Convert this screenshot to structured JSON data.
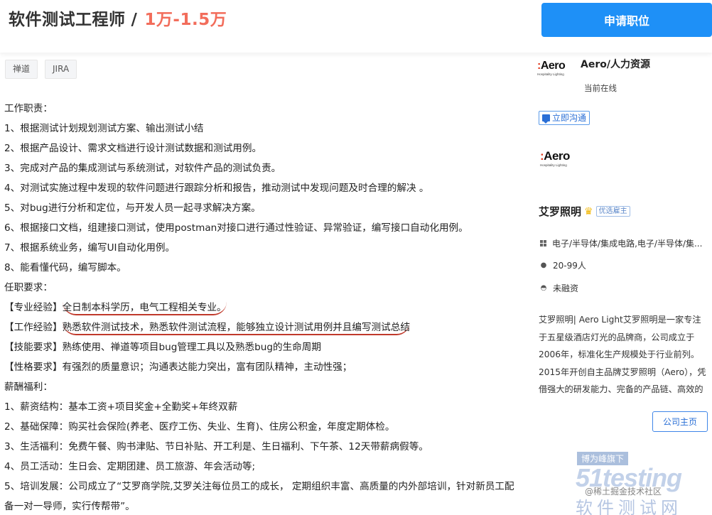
{
  "job": {
    "title": "软件测试工程师",
    "separator": "/",
    "salary": "1万-1.5万",
    "apply_label": "申请职位",
    "tags": [
      "禅道",
      "JIRA"
    ]
  },
  "description": {
    "lines": [
      "工作职责：",
      "1、根据测试计划规划测试方案、输出测试小结",
      "2、根据产品设计、需求文档进行设计测试数据和测试用例。",
      "3、完成对产品的集成测试与系统测试，对软件产品的测试负责。",
      "4、对测试实施过程中发现的软件问题进行跟踪分析和报告，推动测试中发现问题及时合理的解决 。",
      "5、对bug进行分析和定位，与开发人员一起寻求解决方案。",
      "6、根据接口文档，组建接口测试，使用postman对接口进行通过性验证、异常验证，编写接口自动化用例。",
      "7、根据系统业务，编写UI自动化用例。",
      "8、能看懂代码，编写脚本。",
      "任职要求："
    ],
    "req1_label": "【专业经验】",
    "req1_text": "全日制本科学历，电气工程相关专业。",
    "req2_label": "【工作经验】",
    "req2_text": "熟悉软件测试技术，熟悉软件测试流程，能够独立设计测试用例并且编写测试总结",
    "req3": "【技能要求】熟练使用、禅道等项目bug管理工具以及熟悉bug的生命周期",
    "req4": "【性格要求】有强烈的质量意识；沟通表达能力突出，富有团队精神，主动性强；",
    "benefits": [
      "薪酬福利：",
      "1、薪资结构：基本工资+项目奖金+全勤奖+年终双薪",
      "2、基础保障：购买社会保险(养老、医疗工伤、失业、生育)、住房公积金，年度定期体检。",
      "3、生活福利：免费午餐、购书津贴、节日补贴、开工利是、生日福利、下午茶、12天带薪病假等。",
      "4、员工活动：生日会、定期团建、员工旅游、年会活动等;"
    ],
    "benefit5": "5、培训发展：公司成立了“艾罗商学院,艾罗关注每位员工的成长， 定期组织丰富、高质量的内外部培训，针对新员工配备一对一导师，实行传帮带”。"
  },
  "recruiter": {
    "logo_text_prefix": ":",
    "logo_text": "Aero",
    "logo_sub": "Hospitality Lighting",
    "name": "Aero/人力资源",
    "status": "当前在线",
    "chat_label": "立即沟通"
  },
  "company": {
    "name": "艾罗照明",
    "badge": "优选雇主",
    "industry": "电子/半导体/集成电路,电子/半导体/集...",
    "size": "20-99人",
    "funding": "未融资",
    "intro": "艾罗照明| Aero Light艾罗照明是一家专注于五星级酒店灯光的品牌商，公司成立于2006年，标准化生产规模处于行业前列。2015年开创自主品牌艾罗照明（Aero），凭借强大的研发能力、完备的产品链、高效的生产能力",
    "home_label": "公司主页"
  },
  "watermark": {
    "banner": "博为峰旗下",
    "logo": "51testing",
    "cn": "软件测试网",
    "small": "@稀土掘金技术社区"
  }
}
